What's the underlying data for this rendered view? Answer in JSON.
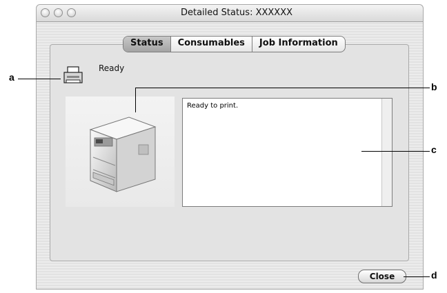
{
  "window": {
    "title": "Detailed Status: XXXXXX",
    "controls": [
      "close-button",
      "minimize-button",
      "zoom-button"
    ]
  },
  "tabs": [
    {
      "label": "Status",
      "selected": true
    },
    {
      "label": "Consumables",
      "selected": false
    },
    {
      "label": "Job Information",
      "selected": false
    }
  ],
  "status": {
    "icon": "printer-status-icon",
    "text": "Ready"
  },
  "printer_image": {
    "icon": "printer-illustration"
  },
  "message": {
    "text": "Ready to print."
  },
  "footer": {
    "close_label": "Close"
  },
  "callouts": {
    "a": "a",
    "b": "b",
    "c1": "c",
    "c2": "d"
  }
}
